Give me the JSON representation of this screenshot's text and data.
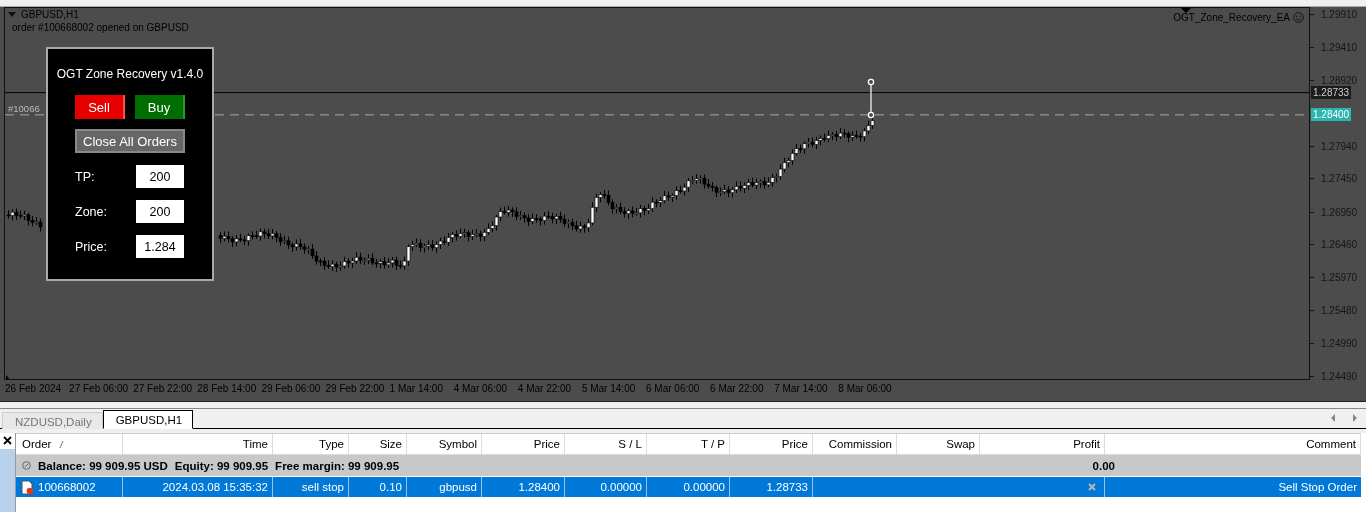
{
  "chart": {
    "title": "GBPUSD,H1",
    "message": "order #100668002 opened on GBPUSD",
    "order_label": "#10066",
    "expert": "OGT_Zone_Recovery_EA",
    "price_axis": [
      "1.29910",
      "1.29410",
      "1.28920",
      "1.27940",
      "1.27450",
      "1.26950",
      "1.26460",
      "1.25970",
      "1.25480",
      "1.24990",
      "1.24490"
    ],
    "price_tags": [
      {
        "kind": "bid",
        "text": "1.28733"
      },
      {
        "kind": "order",
        "text": "1.28400"
      }
    ],
    "time_axis": [
      "26 Feb 2024",
      "27 Feb 06:00",
      "27 Feb 22:00",
      "28 Feb 14:00",
      "29 Feb 06:00",
      "29 Feb 22:00",
      "1 Mar 14:00",
      "4 Mar 06:00",
      "4 Mar 22:00",
      "5 Mar 14:00",
      "6 Mar 06:00",
      "6 Mar 22:00",
      "7 Mar 14:00",
      "8 Mar 06:00"
    ]
  },
  "panel": {
    "title": "OGT Zone Recovery v1.4.0",
    "sell": "Sell",
    "buy": "Buy",
    "close_all": "Close All Orders",
    "fields": [
      {
        "label": "TP:",
        "value": "200"
      },
      {
        "label": "Zone:",
        "value": "200"
      },
      {
        "label": "Price:",
        "value": "1.284"
      }
    ]
  },
  "tabs": [
    {
      "label": "NZDUSD,Daily",
      "selected": false
    },
    {
      "label": "GBPUSD,H1",
      "selected": true
    }
  ],
  "terminal": {
    "columns": [
      "Order",
      "Time",
      "Type",
      "Size",
      "Symbol",
      "Price",
      "S / L",
      "T / P",
      "Price",
      "Commission",
      "Swap",
      "Profit",
      "Comment"
    ],
    "summary": {
      "balance": "Balance: 99 909.95 USD",
      "equity": "Equity: 99 909.95",
      "free_margin": "Free margin: 99 909.95",
      "profit": "0.00"
    },
    "rows": [
      {
        "selected": true,
        "order": "100668002",
        "time": "2024.03.08 15:35:32",
        "type": "sell stop",
        "size": "0.10",
        "symbol": "gbpusd",
        "price": "1.28400",
        "sl": "0.00000",
        "tp": "0.00000",
        "current_price": "1.28733",
        "comment": "Sell Stop Order"
      }
    ]
  }
}
